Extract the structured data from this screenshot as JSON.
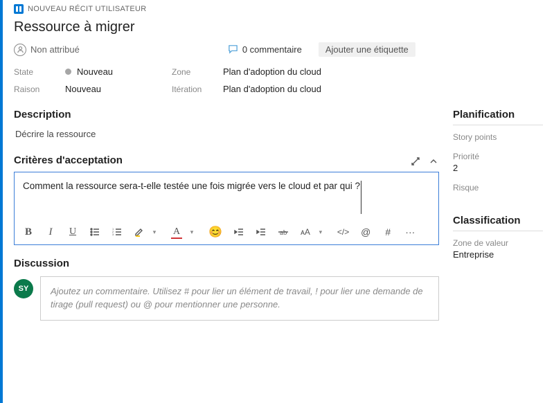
{
  "work_item_type": "NOUVEAU RÉCIT UTILISATEUR",
  "title": "Ressource à migrer",
  "assignee": "Non attribué",
  "comments_count": "0 commentaire",
  "add_tag": "Ajouter une étiquette",
  "fields": {
    "state_label": "State",
    "state_value": "Nouveau",
    "reason_label": "Raison",
    "reason_value": "Nouveau",
    "area_label": "Zone",
    "area_value": "Plan d'adoption du cloud",
    "iteration_label": "Itération",
    "iteration_value": "Plan d'adoption du cloud"
  },
  "description": {
    "title": "Description",
    "text": "Décrire la ressource"
  },
  "acceptance": {
    "title": "Critères d'acceptation",
    "text": "Comment la ressource sera-t-elle testée une fois migrée vers le cloud et par qui ?"
  },
  "discussion": {
    "title": "Discussion",
    "avatar_initials": "SY",
    "placeholder": "Ajoutez un commentaire. Utilisez # pour lier un élément de travail, ! pour lier une demande de tirage (pull request) ou @ pour mentionner une personne."
  },
  "planning": {
    "title": "Planification",
    "story_points_label": "Story points",
    "story_points_value": "",
    "priority_label": "Priorité",
    "priority_value": "2",
    "risk_label": "Risque",
    "risk_value": ""
  },
  "classification": {
    "title": "Classification",
    "value_area_label": "Zone de valeur",
    "value_area_value": "Entreprise"
  },
  "toolbar": {
    "bold": "B",
    "italic": "I",
    "underline": "U",
    "font_color": "A",
    "font_size": "ᴀA",
    "code": "</>",
    "mention": "@",
    "hash": "#",
    "more": "···"
  }
}
